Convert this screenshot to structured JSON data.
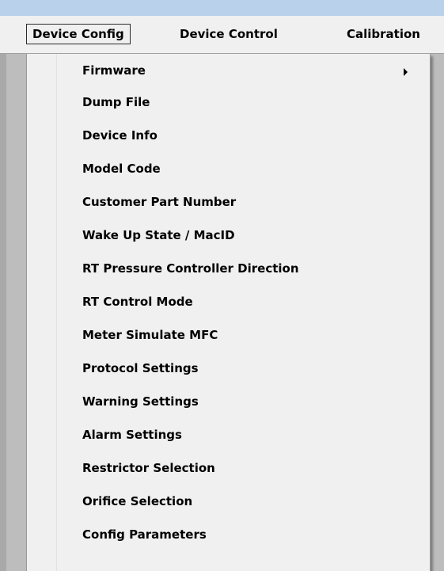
{
  "menubar": {
    "items": [
      {
        "label": "Device Config"
      },
      {
        "label": "Device Control"
      },
      {
        "label": "Calibration"
      }
    ]
  },
  "dropdown": {
    "items": [
      {
        "label": "Firmware",
        "has_submenu": true
      },
      {
        "label": "Dump File"
      },
      {
        "label": "Device Info"
      },
      {
        "label": "Model Code"
      },
      {
        "label": "Customer Part Number"
      },
      {
        "label": "Wake Up State / MacID"
      },
      {
        "label": "RT Pressure Controller Direction"
      },
      {
        "label": "RT Control Mode"
      },
      {
        "label": "Meter Simulate MFC"
      },
      {
        "label": "Protocol Settings"
      },
      {
        "label": "Warning Settings"
      },
      {
        "label": "Alarm Settings"
      },
      {
        "label": "Restrictor Selection"
      },
      {
        "label": "Orifice Selection"
      },
      {
        "label": "Config Parameters"
      }
    ]
  },
  "icons": {
    "submenu_arrow": "chevron-right-icon"
  }
}
